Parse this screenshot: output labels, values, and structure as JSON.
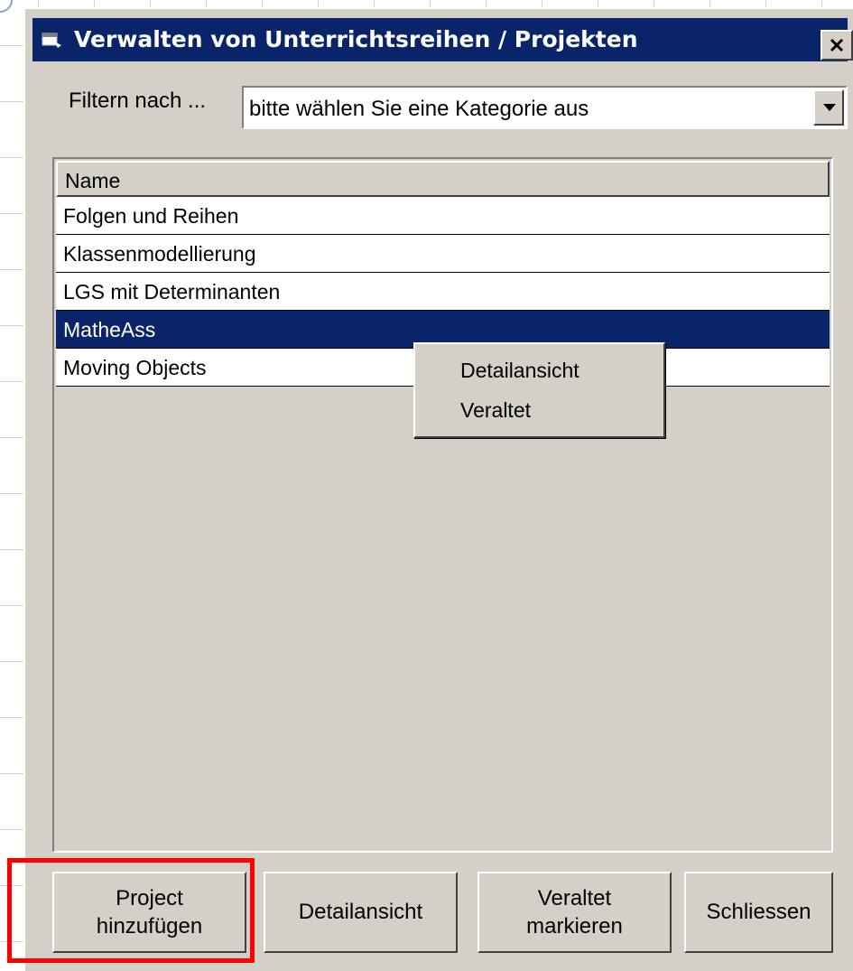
{
  "window": {
    "title": "Verwalten von Unterrichtsreihen / Projekten",
    "close_symbol": "×"
  },
  "filter": {
    "label": "Filtern nach ...",
    "selected_value": "bitte wählen Sie eine Kategorie aus"
  },
  "list": {
    "column_header": "Name",
    "rows": [
      "Folgen und Reihen",
      "Klassenmodellierung",
      "LGS mit Determinanten",
      "MatheAss",
      "Moving Objects"
    ],
    "selected_index": 3
  },
  "context_menu": {
    "items": [
      "Detailansicht",
      "Veraltet"
    ]
  },
  "buttons": {
    "add_project": "Project\nhinzufügen",
    "details": "Detailansicht",
    "mark_outdated": "Veraltet\nmarkieren",
    "close": "Schliessen"
  },
  "colors": {
    "titlebar": "#0a246a",
    "selection": "#0a246a",
    "highlight_box": "#ff0000",
    "dialog_face": "#d4d0c8"
  },
  "icons": {
    "title": "window-app-icon",
    "close": "close-x-icon",
    "dropdown": "triangle-down-icon"
  }
}
